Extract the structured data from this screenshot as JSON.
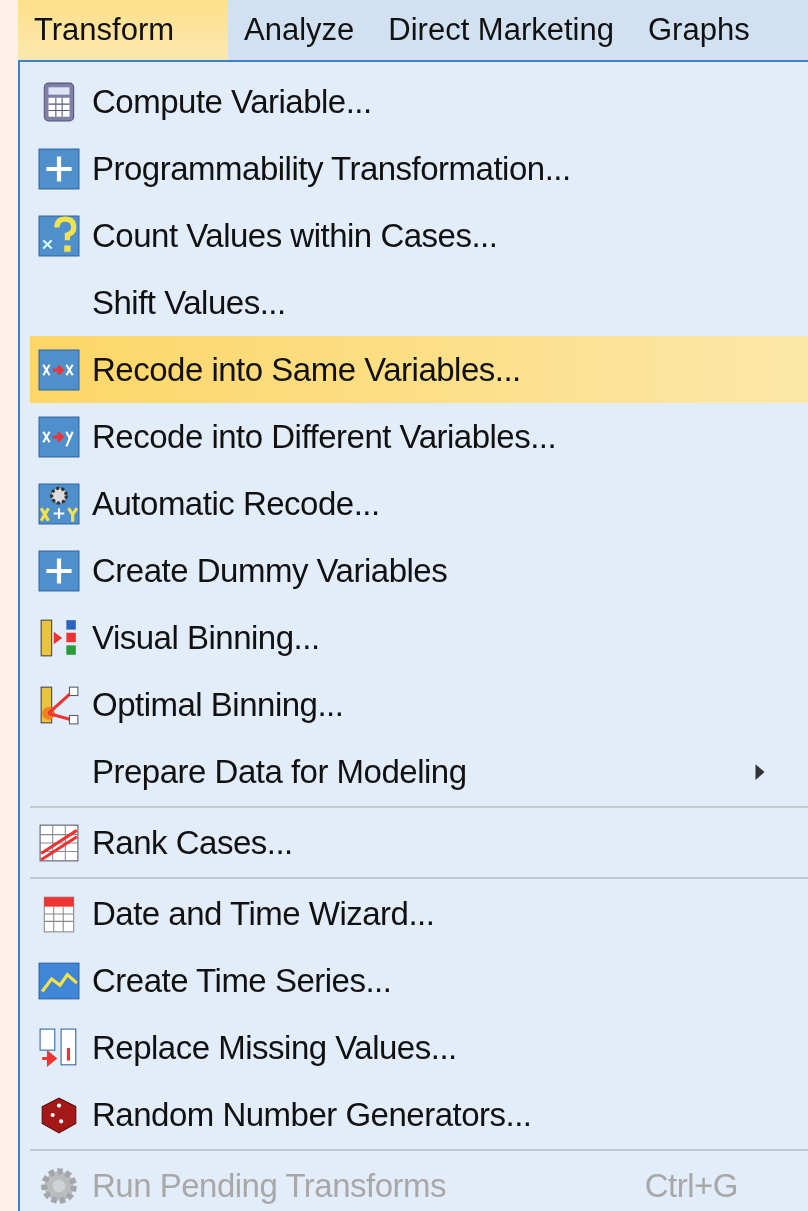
{
  "menubar": [
    {
      "label": "Transform",
      "selected": true
    },
    {
      "label": "Analyze",
      "selected": false
    },
    {
      "label": "Direct Marketing",
      "selected": false
    },
    {
      "label": "Graphs",
      "selected": false
    }
  ],
  "menu": {
    "items": [
      {
        "kind": "item",
        "label": "Compute Variable...",
        "selected": false,
        "disabled": false
      },
      {
        "kind": "item",
        "label": "Programmability Transformation...",
        "selected": false,
        "disabled": false
      },
      {
        "kind": "item",
        "label": "Count Values within Cases...",
        "selected": false,
        "disabled": false
      },
      {
        "kind": "item",
        "label": "Shift Values...",
        "selected": false,
        "disabled": false
      },
      {
        "kind": "item",
        "label": "Recode into Same Variables...",
        "selected": true,
        "disabled": false
      },
      {
        "kind": "item",
        "label": "Recode into Different Variables...",
        "selected": false,
        "disabled": false
      },
      {
        "kind": "item",
        "label": "Automatic Recode...",
        "selected": false,
        "disabled": false
      },
      {
        "kind": "item",
        "label": "Create Dummy Variables",
        "selected": false,
        "disabled": false
      },
      {
        "kind": "item",
        "label": "Visual Binning...",
        "selected": false,
        "disabled": false
      },
      {
        "kind": "item",
        "label": "Optimal Binning...",
        "selected": false,
        "disabled": false
      },
      {
        "kind": "submenu",
        "label": "Prepare Data for Modeling",
        "selected": false,
        "disabled": false
      },
      {
        "kind": "separator"
      },
      {
        "kind": "item",
        "label": "Rank Cases...",
        "selected": false,
        "disabled": false
      },
      {
        "kind": "separator"
      },
      {
        "kind": "item",
        "label": "Date and Time Wizard...",
        "selected": false,
        "disabled": false
      },
      {
        "kind": "item",
        "label": "Create Time Series...",
        "selected": false,
        "disabled": false
      },
      {
        "kind": "item",
        "label": "Replace Missing Values...",
        "selected": false,
        "disabled": false
      },
      {
        "kind": "item",
        "label": "Random Number Generators...",
        "selected": false,
        "disabled": false
      },
      {
        "kind": "separator"
      },
      {
        "kind": "item",
        "label": "Run Pending Transforms",
        "shortcut": "Ctrl+G",
        "selected": false,
        "disabled": true
      }
    ]
  }
}
